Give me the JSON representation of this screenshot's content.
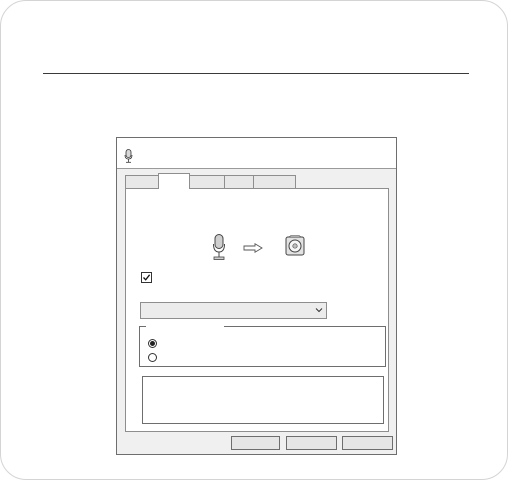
{
  "page": {
    "heading": ""
  },
  "dialog": {
    "title": "",
    "tabs": [
      {
        "label": ""
      },
      {
        "label": ""
      },
      {
        "label": ""
      },
      {
        "label": ""
      },
      {
        "label": ""
      }
    ],
    "active_tab_index": 1,
    "listen_checkbox": {
      "label": "",
      "checked": true
    },
    "playback_device": {
      "value": ""
    },
    "power_group": {
      "title": "",
      "options": [
        {
          "label": "",
          "selected": true
        },
        {
          "label": "",
          "selected": false
        }
      ]
    },
    "info_text": "",
    "buttons": {
      "ok_label": "",
      "cancel_label": "",
      "apply_label": ""
    }
  },
  "icons": {
    "title": "microphone-icon",
    "source": "microphone-icon",
    "direction": "arrow-right-icon",
    "target": "speaker-icon",
    "dropdown": "chevron-down-icon"
  },
  "colors": {
    "dialog_bg": "#f0f0f0",
    "panel_bg": "#ffffff",
    "border": "#8e8e8e"
  }
}
